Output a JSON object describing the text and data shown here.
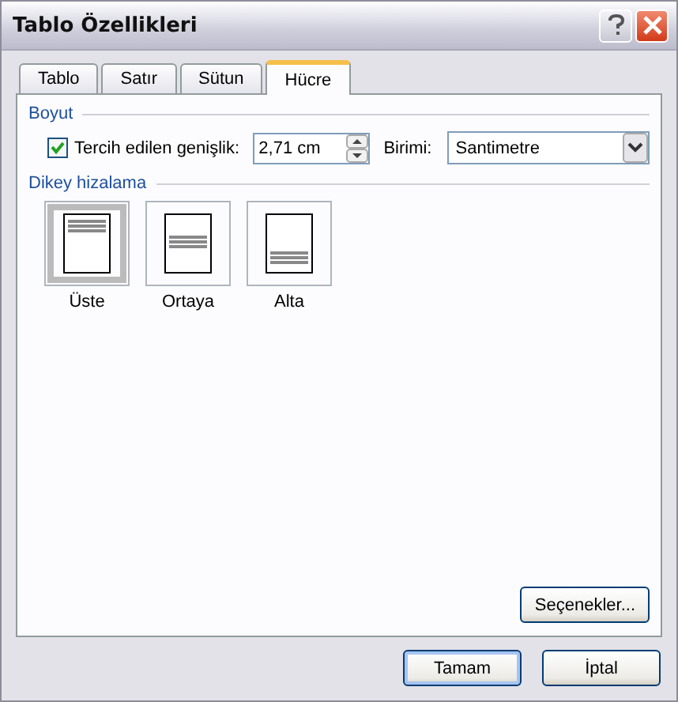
{
  "window": {
    "title": "Tablo Özellikleri"
  },
  "tabs": [
    {
      "label": "Tablo",
      "selected": false
    },
    {
      "label": "Satır",
      "selected": false
    },
    {
      "label": "Sütun",
      "selected": false
    },
    {
      "label": "Hücre",
      "selected": true
    }
  ],
  "size_group": {
    "title": "Boyut",
    "preferred_width": {
      "label": "Tercih edilen genişlik:",
      "checked": true,
      "value": "2,71 cm"
    },
    "unit": {
      "label": "Birimi:",
      "value": "Santimetre"
    }
  },
  "align_group": {
    "title": "Dikey hizalama",
    "options": [
      {
        "label": "Üste",
        "kind": "top",
        "selected": true
      },
      {
        "label": "Ortaya",
        "kind": "middle",
        "selected": false
      },
      {
        "label": "Alta",
        "kind": "bottom",
        "selected": false
      }
    ]
  },
  "options_button": "Seçenekler...",
  "buttons": [
    {
      "label": "Tamam",
      "default": true
    },
    {
      "label": "İptal",
      "default": false
    }
  ]
}
